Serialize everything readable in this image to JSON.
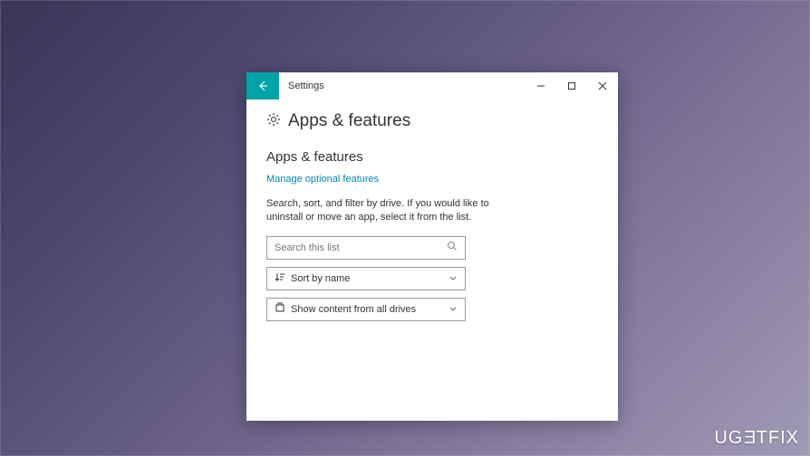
{
  "window": {
    "title": "Settings"
  },
  "page": {
    "title": "Apps & features"
  },
  "section": {
    "title": "Apps & features",
    "link": "Manage optional features",
    "description": "Search, sort, and filter by drive. If you would like to uninstall or move an app, select it from the list."
  },
  "search": {
    "placeholder": "Search this list"
  },
  "sort": {
    "label": "Sort by name"
  },
  "filter": {
    "label": "Show content from all drives"
  },
  "watermark": "UGETFIX"
}
